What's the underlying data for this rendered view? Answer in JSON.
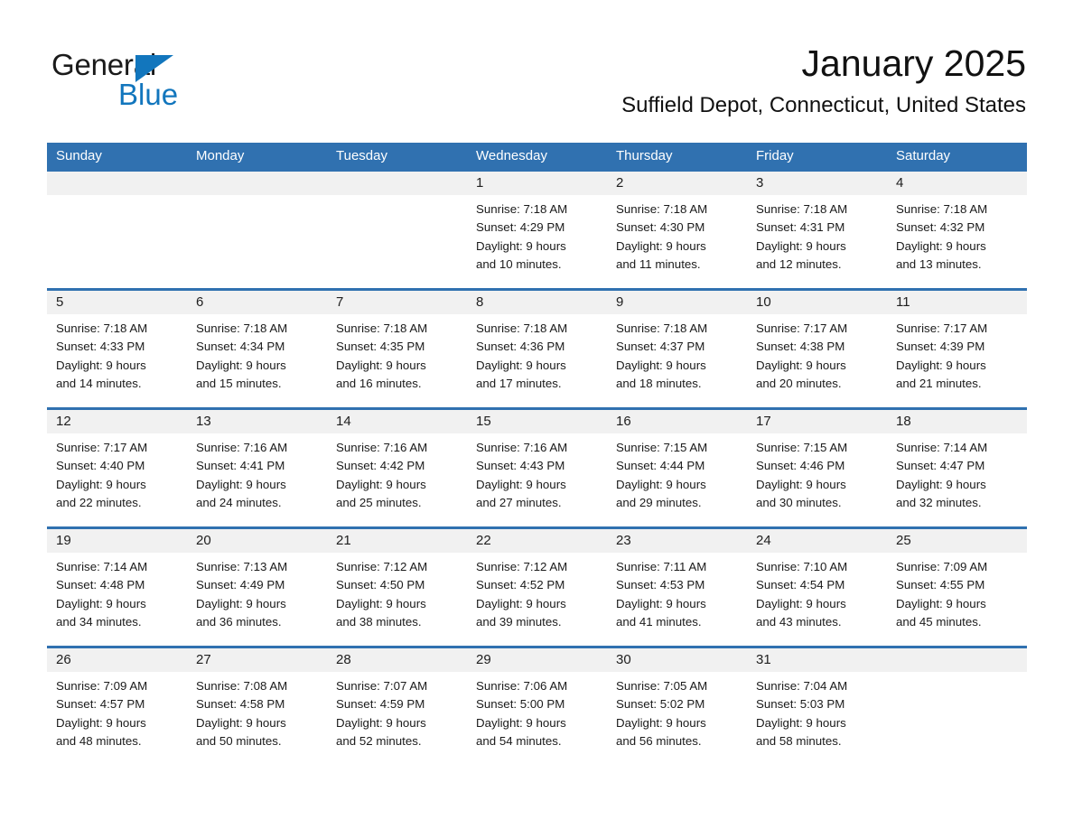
{
  "brand": {
    "name_part1": "General",
    "name_part2": "Blue",
    "triangle_color": "#1276bd"
  },
  "header": {
    "month_title": "January 2025",
    "location": "Suffield Depot, Connecticut, United States"
  },
  "theme": {
    "header_blue": "#3071b0",
    "day_band_gray": "#f1f1f1",
    "text_color": "#1a1a1a",
    "page_background": "#ffffff"
  },
  "weekdays": [
    "Sunday",
    "Monday",
    "Tuesday",
    "Wednesday",
    "Thursday",
    "Friday",
    "Saturday"
  ],
  "weeks": [
    [
      {
        "day": "",
        "sunrise": "",
        "sunset": "",
        "daylight_line1": "",
        "daylight_line2": "",
        "empty": true
      },
      {
        "day": "",
        "sunrise": "",
        "sunset": "",
        "daylight_line1": "",
        "daylight_line2": "",
        "empty": true
      },
      {
        "day": "",
        "sunrise": "",
        "sunset": "",
        "daylight_line1": "",
        "daylight_line2": "",
        "empty": true
      },
      {
        "day": "1",
        "sunrise": "Sunrise: 7:18 AM",
        "sunset": "Sunset: 4:29 PM",
        "daylight_line1": "Daylight: 9 hours",
        "daylight_line2": "and 10 minutes."
      },
      {
        "day": "2",
        "sunrise": "Sunrise: 7:18 AM",
        "sunset": "Sunset: 4:30 PM",
        "daylight_line1": "Daylight: 9 hours",
        "daylight_line2": "and 11 minutes."
      },
      {
        "day": "3",
        "sunrise": "Sunrise: 7:18 AM",
        "sunset": "Sunset: 4:31 PM",
        "daylight_line1": "Daylight: 9 hours",
        "daylight_line2": "and 12 minutes."
      },
      {
        "day": "4",
        "sunrise": "Sunrise: 7:18 AM",
        "sunset": "Sunset: 4:32 PM",
        "daylight_line1": "Daylight: 9 hours",
        "daylight_line2": "and 13 minutes."
      }
    ],
    [
      {
        "day": "5",
        "sunrise": "Sunrise: 7:18 AM",
        "sunset": "Sunset: 4:33 PM",
        "daylight_line1": "Daylight: 9 hours",
        "daylight_line2": "and 14 minutes."
      },
      {
        "day": "6",
        "sunrise": "Sunrise: 7:18 AM",
        "sunset": "Sunset: 4:34 PM",
        "daylight_line1": "Daylight: 9 hours",
        "daylight_line2": "and 15 minutes."
      },
      {
        "day": "7",
        "sunrise": "Sunrise: 7:18 AM",
        "sunset": "Sunset: 4:35 PM",
        "daylight_line1": "Daylight: 9 hours",
        "daylight_line2": "and 16 minutes."
      },
      {
        "day": "8",
        "sunrise": "Sunrise: 7:18 AM",
        "sunset": "Sunset: 4:36 PM",
        "daylight_line1": "Daylight: 9 hours",
        "daylight_line2": "and 17 minutes."
      },
      {
        "day": "9",
        "sunrise": "Sunrise: 7:18 AM",
        "sunset": "Sunset: 4:37 PM",
        "daylight_line1": "Daylight: 9 hours",
        "daylight_line2": "and 18 minutes."
      },
      {
        "day": "10",
        "sunrise": "Sunrise: 7:17 AM",
        "sunset": "Sunset: 4:38 PM",
        "daylight_line1": "Daylight: 9 hours",
        "daylight_line2": "and 20 minutes."
      },
      {
        "day": "11",
        "sunrise": "Sunrise: 7:17 AM",
        "sunset": "Sunset: 4:39 PM",
        "daylight_line1": "Daylight: 9 hours",
        "daylight_line2": "and 21 minutes."
      }
    ],
    [
      {
        "day": "12",
        "sunrise": "Sunrise: 7:17 AM",
        "sunset": "Sunset: 4:40 PM",
        "daylight_line1": "Daylight: 9 hours",
        "daylight_line2": "and 22 minutes."
      },
      {
        "day": "13",
        "sunrise": "Sunrise: 7:16 AM",
        "sunset": "Sunset: 4:41 PM",
        "daylight_line1": "Daylight: 9 hours",
        "daylight_line2": "and 24 minutes."
      },
      {
        "day": "14",
        "sunrise": "Sunrise: 7:16 AM",
        "sunset": "Sunset: 4:42 PM",
        "daylight_line1": "Daylight: 9 hours",
        "daylight_line2": "and 25 minutes."
      },
      {
        "day": "15",
        "sunrise": "Sunrise: 7:16 AM",
        "sunset": "Sunset: 4:43 PM",
        "daylight_line1": "Daylight: 9 hours",
        "daylight_line2": "and 27 minutes."
      },
      {
        "day": "16",
        "sunrise": "Sunrise: 7:15 AM",
        "sunset": "Sunset: 4:44 PM",
        "daylight_line1": "Daylight: 9 hours",
        "daylight_line2": "and 29 minutes."
      },
      {
        "day": "17",
        "sunrise": "Sunrise: 7:15 AM",
        "sunset": "Sunset: 4:46 PM",
        "daylight_line1": "Daylight: 9 hours",
        "daylight_line2": "and 30 minutes."
      },
      {
        "day": "18",
        "sunrise": "Sunrise: 7:14 AM",
        "sunset": "Sunset: 4:47 PM",
        "daylight_line1": "Daylight: 9 hours",
        "daylight_line2": "and 32 minutes."
      }
    ],
    [
      {
        "day": "19",
        "sunrise": "Sunrise: 7:14 AM",
        "sunset": "Sunset: 4:48 PM",
        "daylight_line1": "Daylight: 9 hours",
        "daylight_line2": "and 34 minutes."
      },
      {
        "day": "20",
        "sunrise": "Sunrise: 7:13 AM",
        "sunset": "Sunset: 4:49 PM",
        "daylight_line1": "Daylight: 9 hours",
        "daylight_line2": "and 36 minutes."
      },
      {
        "day": "21",
        "sunrise": "Sunrise: 7:12 AM",
        "sunset": "Sunset: 4:50 PM",
        "daylight_line1": "Daylight: 9 hours",
        "daylight_line2": "and 38 minutes."
      },
      {
        "day": "22",
        "sunrise": "Sunrise: 7:12 AM",
        "sunset": "Sunset: 4:52 PM",
        "daylight_line1": "Daylight: 9 hours",
        "daylight_line2": "and 39 minutes."
      },
      {
        "day": "23",
        "sunrise": "Sunrise: 7:11 AM",
        "sunset": "Sunset: 4:53 PM",
        "daylight_line1": "Daylight: 9 hours",
        "daylight_line2": "and 41 minutes."
      },
      {
        "day": "24",
        "sunrise": "Sunrise: 7:10 AM",
        "sunset": "Sunset: 4:54 PM",
        "daylight_line1": "Daylight: 9 hours",
        "daylight_line2": "and 43 minutes."
      },
      {
        "day": "25",
        "sunrise": "Sunrise: 7:09 AM",
        "sunset": "Sunset: 4:55 PM",
        "daylight_line1": "Daylight: 9 hours",
        "daylight_line2": "and 45 minutes."
      }
    ],
    [
      {
        "day": "26",
        "sunrise": "Sunrise: 7:09 AM",
        "sunset": "Sunset: 4:57 PM",
        "daylight_line1": "Daylight: 9 hours",
        "daylight_line2": "and 48 minutes."
      },
      {
        "day": "27",
        "sunrise": "Sunrise: 7:08 AM",
        "sunset": "Sunset: 4:58 PM",
        "daylight_line1": "Daylight: 9 hours",
        "daylight_line2": "and 50 minutes."
      },
      {
        "day": "28",
        "sunrise": "Sunrise: 7:07 AM",
        "sunset": "Sunset: 4:59 PM",
        "daylight_line1": "Daylight: 9 hours",
        "daylight_line2": "and 52 minutes."
      },
      {
        "day": "29",
        "sunrise": "Sunrise: 7:06 AM",
        "sunset": "Sunset: 5:00 PM",
        "daylight_line1": "Daylight: 9 hours",
        "daylight_line2": "and 54 minutes."
      },
      {
        "day": "30",
        "sunrise": "Sunrise: 7:05 AM",
        "sunset": "Sunset: 5:02 PM",
        "daylight_line1": "Daylight: 9 hours",
        "daylight_line2": "and 56 minutes."
      },
      {
        "day": "31",
        "sunrise": "Sunrise: 7:04 AM",
        "sunset": "Sunset: 5:03 PM",
        "daylight_line1": "Daylight: 9 hours",
        "daylight_line2": "and 58 minutes."
      },
      {
        "day": "",
        "sunrise": "",
        "sunset": "",
        "daylight_line1": "",
        "daylight_line2": "",
        "empty": true
      }
    ]
  ]
}
